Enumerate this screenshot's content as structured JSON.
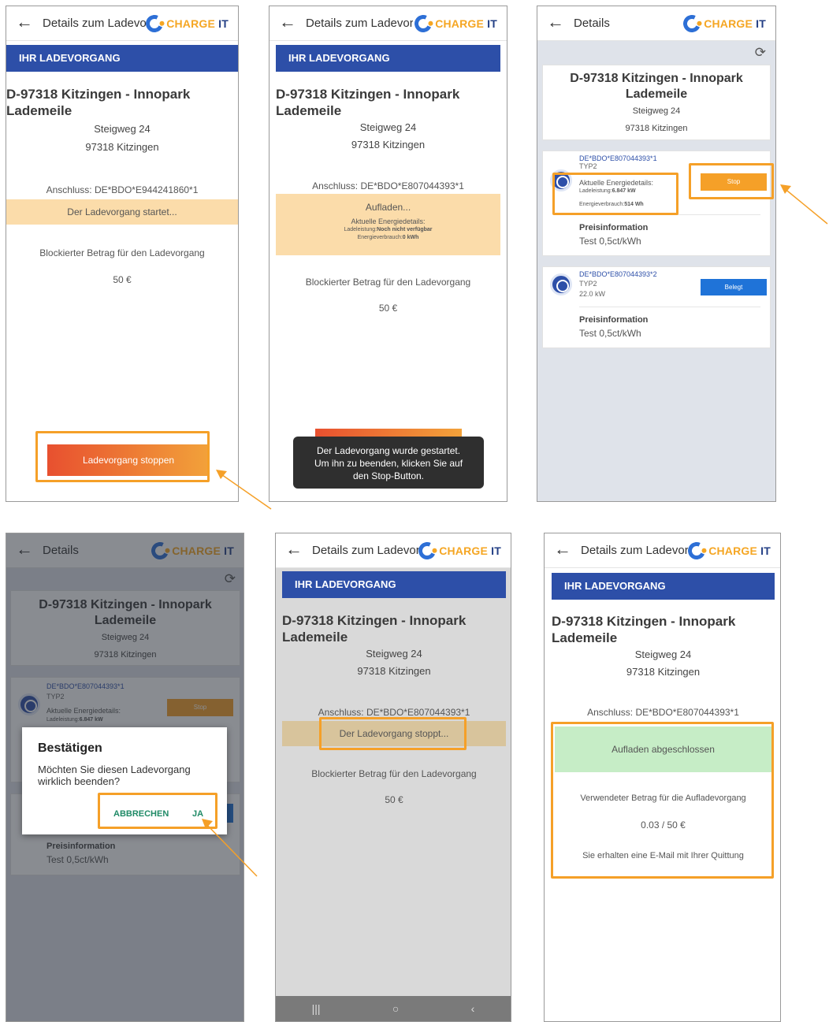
{
  "app": {
    "back_glyph": "←",
    "title_long": "Details zum Ladevorgang",
    "title_short": "Details",
    "logo_c": "CHARGE",
    "logo_it": " IT",
    "refresh_glyph": "⟳"
  },
  "section_header": "IHR LADEVORGANG",
  "location": {
    "name": "D-97318 Kitzingen - Innopark Lademeile",
    "name_line1": "D-97318 Kitzingen - Innopark",
    "name_line2": "Lademeile",
    "street": "Steigweg 24",
    "city": "97318 Kitzingen"
  },
  "screen1": {
    "connector": "Anschluss: DE*BDO*E944241860*1",
    "status": "Der Ladevorgang startet...",
    "blocked_label": "Blockierter Betrag für den Ladevorgang",
    "blocked_amount": "50 €",
    "stop_button": "Ladevorgang stoppen"
  },
  "screen2": {
    "connector": "Anschluss: DE*BDO*E807044393*1",
    "status": "Aufladen...",
    "energy_title": "Aktuelle Energiedetails:",
    "power_label": "Ladeleistung:",
    "power_value": "Noch nicht verfügbar",
    "consumption_label": "Energieverbrauch:",
    "consumption_value": "0 kWh",
    "blocked_label": "Blockierter Betrag für den Ladevorgang",
    "blocked_amount": "50 €",
    "toast_line1": "Der Ladevorgang wurde gestartet.",
    "toast_line2": "Um ihn zu beenden, klicken Sie auf",
    "toast_line3": "den Stop-Button."
  },
  "screen3": {
    "evse1_id": "DE*BDO*E807044393*1",
    "evse1_type": "TYP2",
    "energy_title": "Aktuelle Energiedetails:",
    "power_label": "Ladeleistung:",
    "power_value": "6.847 kW",
    "consumption_label": "Energieverbrauch:",
    "consumption_value": "514 Wh",
    "stop_button": "Stop",
    "price_title": "Preisinformation",
    "price_value": "Test 0,5ct/kWh",
    "evse2_id": "DE*BDO*E807044393*2",
    "evse2_type": "TYP2",
    "evse2_power": "22.0 kW",
    "occupied_button": "Belegt"
  },
  "screen4": {
    "dialog_title": "Bestätigen",
    "dialog_text": "Möchten Sie diesen Ladevorgang wirklich beenden?",
    "cancel": "ABBRECHEN",
    "confirm": "JA"
  },
  "screen5": {
    "connector": "Anschluss: DE*BDO*E807044393*1",
    "status": "Der Ladevorgang stoppt...",
    "blocked_label": "Blockierter Betrag für den Ladevorgang",
    "blocked_amount": "50 €",
    "nav_recent": "|||",
    "nav_home": "○",
    "nav_back": "‹"
  },
  "screen6": {
    "connector": "Anschluss: DE*BDO*E807044393*1",
    "status": "Aufladen abgeschlossen",
    "used_label": "Verwendeter Betrag für die Aufladevorgang",
    "used_amount": "0.03 / 50 €",
    "email_note": "Sie erhalten eine E-Mail mit Ihrer Quittung"
  },
  "colors": {
    "primary_blue": "#2d4fa8",
    "accent_orange": "#f5a028",
    "status_orange_bg": "#fbdcaa",
    "success_green_bg": "#c6edc6"
  }
}
